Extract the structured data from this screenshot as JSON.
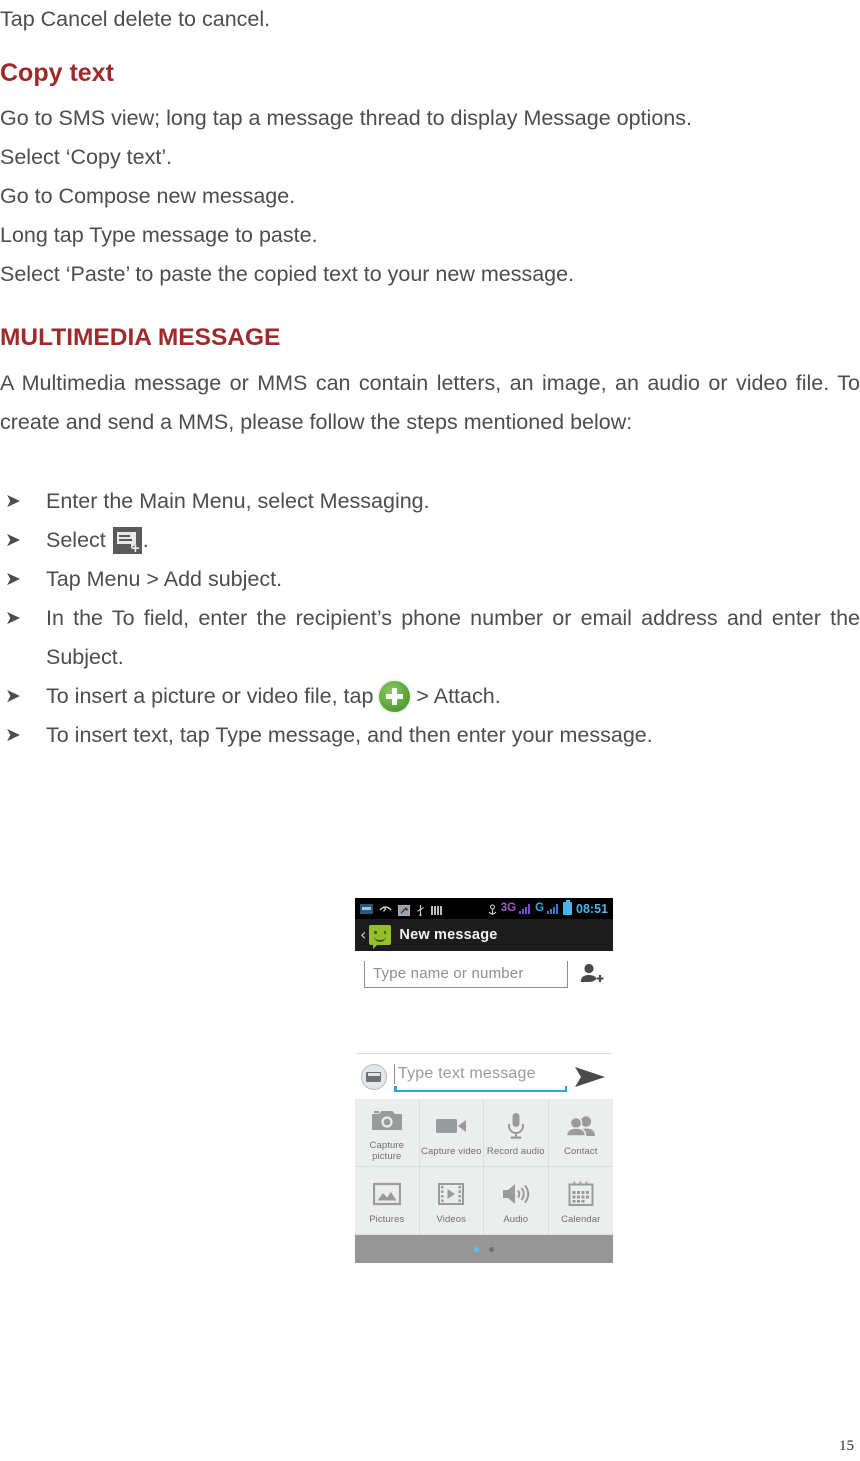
{
  "document": {
    "page_number": "15",
    "accent_heading_color": "#9e2a2b",
    "body_text_color": "#4d4d4d",
    "intro_line": "Tap Cancel delete to cancel.",
    "sections": [
      {
        "heading": "Copy text",
        "paragraphs": [
          "Go to SMS view; long tap a message thread to display Message options.",
          "Select ‘Copy text’.",
          "Go to Compose new message.",
          "Long tap Type message to paste.",
          "Select ‘Paste’ to paste the copied text to your new message."
        ]
      },
      {
        "heading": "MULTIMEDIA MESSAGE",
        "paragraphs": [
          "A Multimedia message or MMS can contain letters, an image, an audio or video file. To create and send a MMS, please follow the steps mentioned below:"
        ]
      }
    ],
    "bullet_marker": "➤",
    "bullets": [
      {
        "before": "Enter the Main Menu, select Messaging.",
        "icon": "",
        "after": ""
      },
      {
        "before": "Select ",
        "icon": "compose-message-icon",
        "after": "."
      },
      {
        "before": "Tap Menu > Add subject.",
        "icon": "",
        "after": ""
      },
      {
        "before": "In the To field, enter the recipient’s phone number or email address and enter the Subject.",
        "icon": "",
        "after": ""
      },
      {
        "before": "To insert a picture or video file, tap ",
        "icon": "green-plus-icon",
        "after": "  > Attach."
      },
      {
        "before": "To insert text, tap Type message, and then enter your message.",
        "icon": "",
        "after": ""
      }
    ]
  },
  "screenshot": {
    "statusbar": {
      "icons_left": [
        "sim-card-icon",
        "missed-call-icon",
        "cursor-icon",
        "usb-icon",
        "signal-bars-icon"
      ],
      "tether_icon": "tether-icon",
      "network_3g_label": "3G",
      "network_g_label": "G",
      "battery_icon": "battery-icon",
      "clock": "08:51",
      "colors": {
        "background": "#000000",
        "network_3g": "#9b5fd0",
        "network_g": "#3ba3e0",
        "clock": "#4db3e8"
      }
    },
    "actionbar": {
      "back_label": "‹",
      "app_icon": "messaging-app-icon",
      "title": "New message"
    },
    "recipient": {
      "placeholder": "Type name or number",
      "add_contact_icon": "add-contact-icon"
    },
    "compose": {
      "keyboard_icon": "keyboard-icon",
      "placeholder": "Type text message",
      "send_icon": "send-icon",
      "underline_color": "#2fa3dd"
    },
    "attachments": [
      {
        "label": "Capture picture",
        "icon": "camera-icon"
      },
      {
        "label": "Capture video",
        "icon": "video-camera-icon"
      },
      {
        "label": "Record audio",
        "icon": "microphone-icon"
      },
      {
        "label": "Contact",
        "icon": "contacts-icon"
      },
      {
        "label": "Pictures",
        "icon": "picture-icon"
      },
      {
        "label": "Videos",
        "icon": "film-icon"
      },
      {
        "label": "Audio",
        "icon": "speaker-icon"
      },
      {
        "label": "Calendar",
        "icon": "calendar-icon"
      }
    ],
    "pager": {
      "pages": 2,
      "active_index": 0,
      "active_color": "#4fc3f7",
      "inactive_color": "#6f6f6f"
    }
  }
}
